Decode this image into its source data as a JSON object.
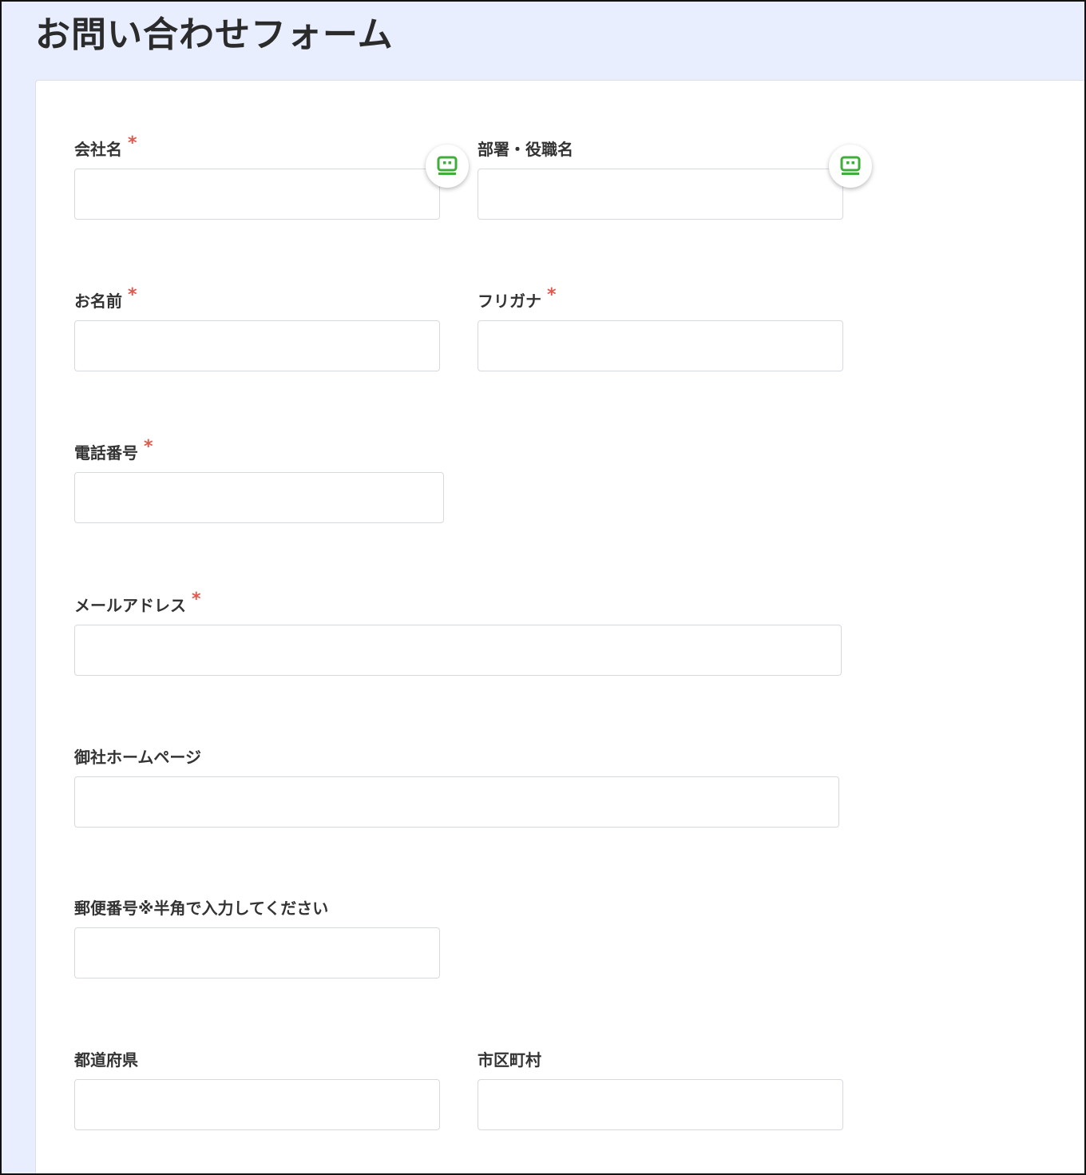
{
  "header": {
    "title": "お問い合わせフォーム"
  },
  "required_mark": "*",
  "accent_colors": {
    "background": "#e8eefd",
    "required": "#e2574c",
    "autofill_icon": "#3fae3a"
  },
  "form": {
    "fields": [
      {
        "key": "company",
        "label": "会社名",
        "required": true,
        "value": "",
        "autofill_icon": "password-manager-icon"
      },
      {
        "key": "department",
        "label": "部署・役職名",
        "required": false,
        "value": "",
        "autofill_icon": "password-manager-icon"
      },
      {
        "key": "name",
        "label": "お名前",
        "required": true,
        "value": ""
      },
      {
        "key": "furigana",
        "label": "フリガナ",
        "required": true,
        "value": ""
      },
      {
        "key": "phone",
        "label": "電話番号",
        "required": true,
        "value": ""
      },
      {
        "key": "email",
        "label": "メールアドレス",
        "required": true,
        "value": ""
      },
      {
        "key": "homepage",
        "label": "御社ホームページ",
        "required": false,
        "value": ""
      },
      {
        "key": "postal",
        "label": "郵便番号※半角で入力してください",
        "required": false,
        "value": ""
      },
      {
        "key": "prefecture",
        "label": "都道府県",
        "required": false,
        "value": ""
      },
      {
        "key": "city",
        "label": "市区町村",
        "required": false,
        "value": ""
      }
    ]
  }
}
